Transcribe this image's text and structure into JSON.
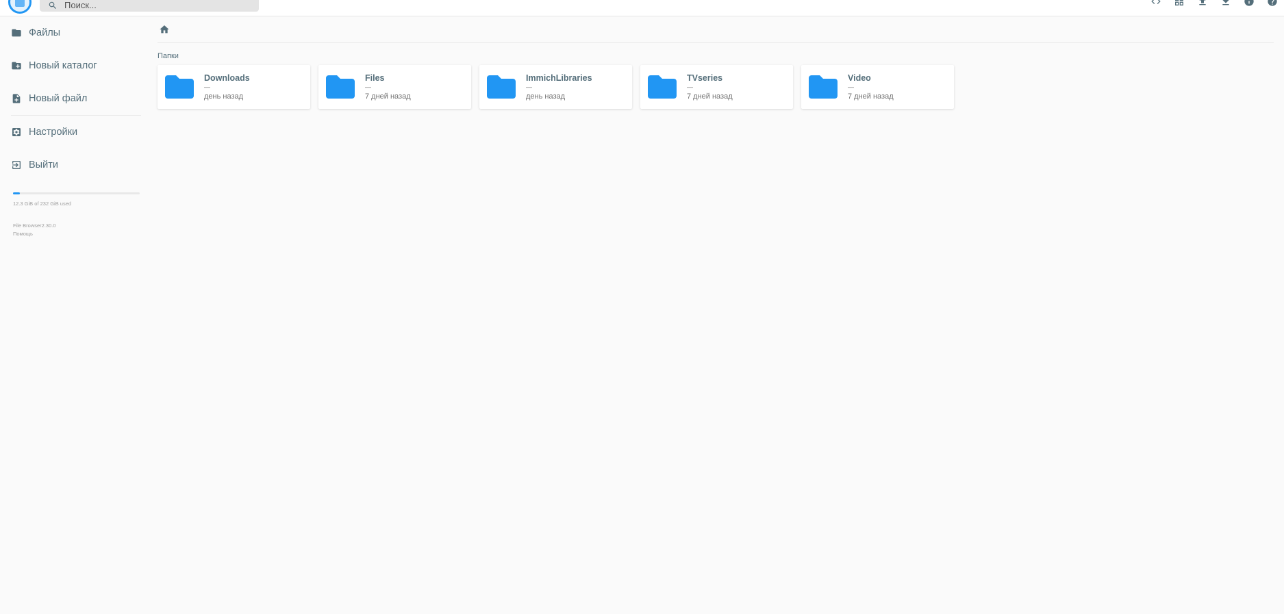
{
  "header": {
    "search_placeholder": "Поиск...",
    "actions": [
      "code-icon",
      "grid-view-icon",
      "upload-icon",
      "download-icon",
      "info-icon",
      "help-icon"
    ]
  },
  "sidebar": {
    "items": [
      {
        "label": "Файлы",
        "icon": "folder-icon"
      },
      {
        "label": "Новый каталог",
        "icon": "new-folder-icon"
      },
      {
        "label": "Новый файл",
        "icon": "new-file-icon"
      },
      {
        "label": "Настройки",
        "icon": "settings-icon"
      },
      {
        "label": "Выйти",
        "icon": "logout-icon"
      }
    ],
    "usage": {
      "text": "12.3 GiB of 232 GiB used",
      "fraction": 0.053
    },
    "credits": {
      "version": "File Browser2.30.0",
      "help": "Помощь"
    }
  },
  "main": {
    "section_title": "Папки",
    "folders": [
      {
        "name": "Downloads",
        "size": "—",
        "modified": "день назад"
      },
      {
        "name": "Files",
        "size": "—",
        "modified": "7 дней назад"
      },
      {
        "name": "ImmichLibraries",
        "size": "—",
        "modified": "день назад"
      },
      {
        "name": "TVseries",
        "size": "—",
        "modified": "7 дней назад"
      },
      {
        "name": "Video",
        "size": "—",
        "modified": "7 дней назад"
      }
    ]
  },
  "colors": {
    "accent": "#2196f3",
    "folder": "#2196f3",
    "text_muted": "#546e7a"
  }
}
